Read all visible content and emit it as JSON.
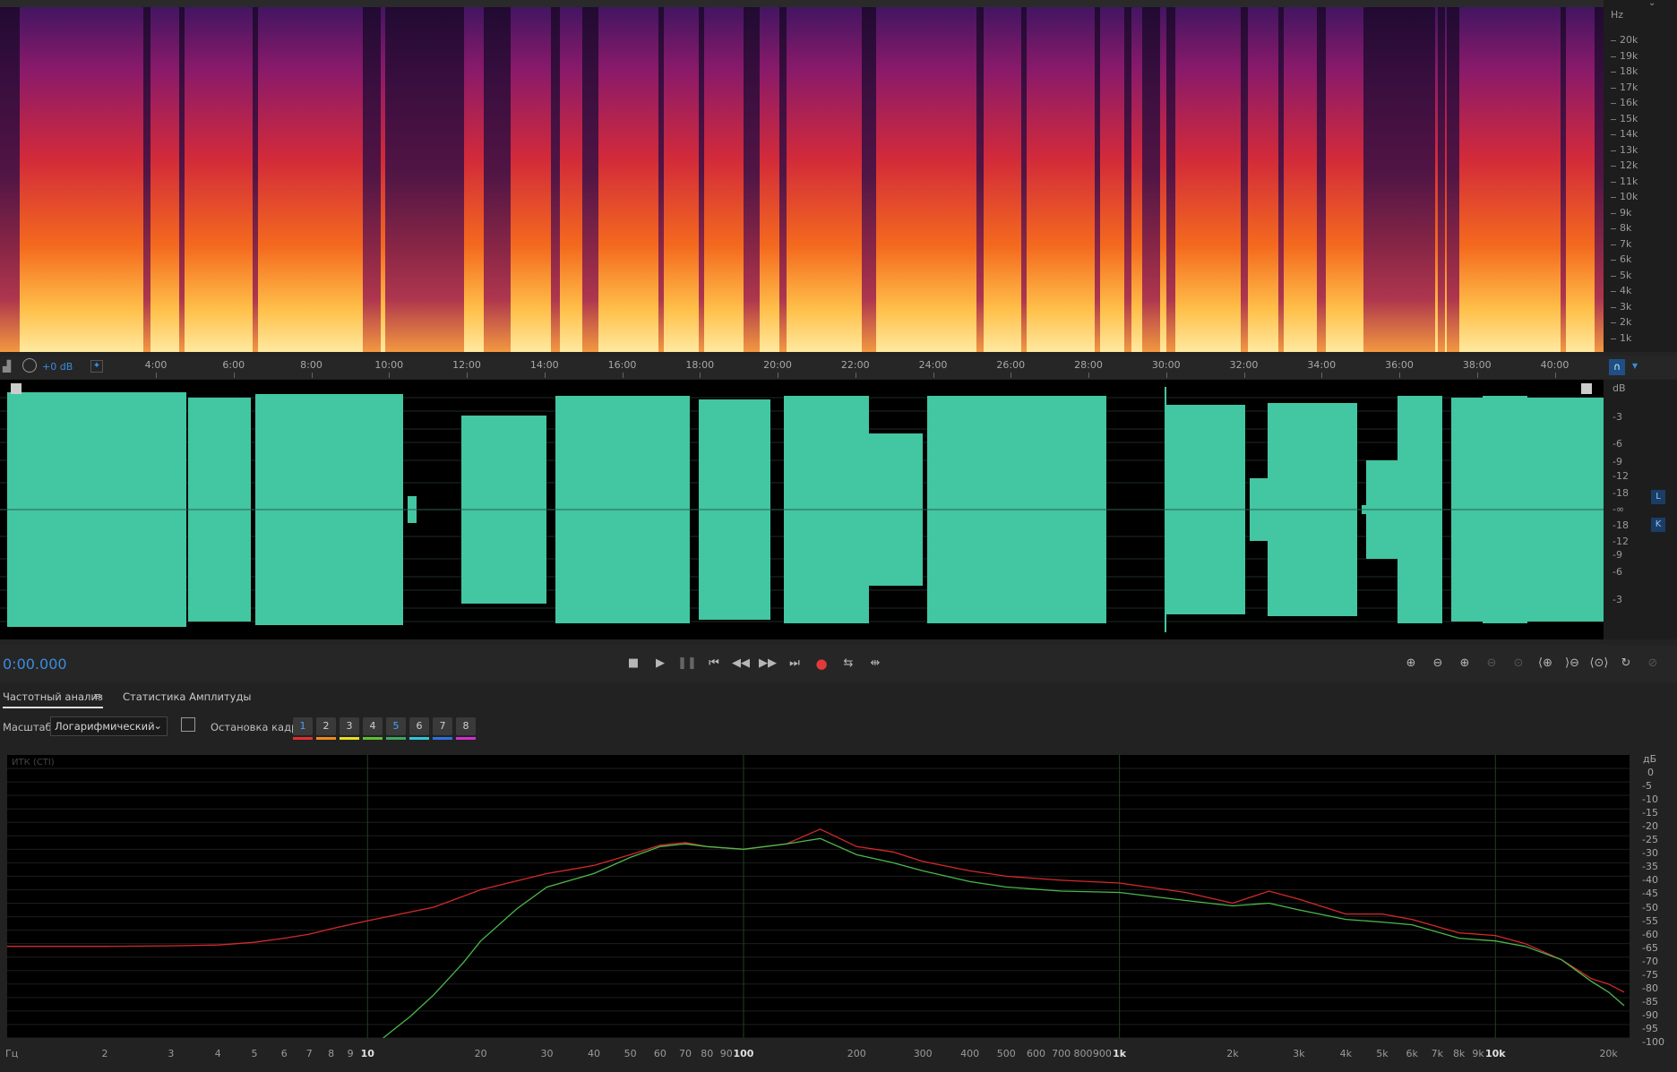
{
  "spectrogram": {
    "unit_label": "Hz",
    "ticks": [
      "20k",
      "19k",
      "18k",
      "17k",
      "16k",
      "15k",
      "14k",
      "13k",
      "12k",
      "11k",
      "10k",
      "9k",
      "8k",
      "7k",
      "6k",
      "5k",
      "4k",
      "3k",
      "2k",
      "1k"
    ]
  },
  "timeline": {
    "gain_label": "+0 dB",
    "ticks": [
      "4:00",
      "6:00",
      "8:00",
      "10:00",
      "12:00",
      "14:00",
      "16:00",
      "18:00",
      "20:00",
      "22:00",
      "24:00",
      "26:00",
      "28:00",
      "30:00",
      "32:00",
      "34:00",
      "36:00",
      "38:00",
      "40:00"
    ]
  },
  "waveform": {
    "unit_label": "dB",
    "ticks_top": [
      "-3",
      "-6",
      "-9",
      "-12",
      "-18",
      "-∞"
    ],
    "ticks_bottom": [
      "-18",
      "-12",
      "-9",
      "-6",
      "-3"
    ],
    "channel_left": "L",
    "channel_right": "K"
  },
  "transport": {
    "timecode": "0:00.000"
  },
  "panel": {
    "tabs": [
      "Частотный анализ",
      "Статистика Амплитуды"
    ],
    "scale_label": "Масштаб:",
    "scale_value": "Логарифмический",
    "freeze_label": "Остановка кадра:",
    "frame_buttons": [
      "1",
      "2",
      "3",
      "4",
      "5",
      "6",
      "7",
      "8"
    ],
    "frame_colors": [
      "#e03030",
      "#f08a20",
      "#e8e020",
      "#60c030",
      "#40a860",
      "#30c8d8",
      "#3070e0",
      "#d030d0"
    ],
    "graph_watermark": "ИТК (CTI)"
  },
  "chart_data": {
    "type": "line",
    "xlabel": "Гц",
    "ylabel": "дБ",
    "x_scale": "log",
    "ylim": [
      -100,
      5
    ],
    "y_ticks": [
      "0",
      "-5",
      "-10",
      "-15",
      "-20",
      "-25",
      "-30",
      "-35",
      "-40",
      "-45",
      "-50",
      "-55",
      "-60",
      "-65",
      "-70",
      "-75",
      "-80",
      "-85",
      "-90",
      "-95",
      "-100"
    ],
    "x_ticks": [
      "2",
      "3",
      "4",
      "5",
      "6",
      "7",
      "8",
      "9",
      "10",
      "20",
      "30",
      "40",
      "50",
      "60",
      "70",
      "80",
      "90",
      "100",
      "200",
      "300",
      "400",
      "500",
      "600",
      "700",
      "800",
      "900",
      "1k",
      "2k",
      "3k",
      "4k",
      "5k",
      "6k",
      "7k",
      "8k",
      "9k",
      "10k",
      "20k"
    ],
    "series": [
      {
        "color": "#d42a2a",
        "x": [
          1,
          2,
          3,
          4,
          5,
          6,
          7,
          8,
          10,
          15,
          20,
          30,
          40,
          50,
          60,
          70,
          80,
          100,
          130,
          160,
          200,
          250,
          300,
          400,
          500,
          700,
          1000,
          1500,
          2000,
          2500,
          3000,
          4000,
          5000,
          6000,
          8000,
          10000,
          12000,
          15000,
          18000,
          20000,
          22000
        ],
        "y": [
          -66,
          -66,
          -65.8,
          -65.5,
          -64.5,
          -63,
          -61.5,
          -59.5,
          -56.5,
          -51.5,
          -45,
          -39,
          -36,
          -32,
          -28.5,
          -27.5,
          -29,
          -30,
          -28,
          -22.5,
          -29,
          -31,
          -34.5,
          -38,
          -40,
          -41.5,
          -42.5,
          -46,
          -50,
          -45.5,
          -48.5,
          -54,
          -54,
          -56,
          -61,
          -62,
          -65,
          -71,
          -78,
          -80,
          -83
        ]
      },
      {
        "color": "#4bb84b",
        "x": [
          11,
          13,
          15,
          18,
          20,
          25,
          30,
          40,
          50,
          60,
          70,
          80,
          100,
          130,
          160,
          200,
          250,
          300,
          400,
          500,
          700,
          1000,
          1500,
          2000,
          2500,
          3000,
          4000,
          5000,
          6000,
          8000,
          10000,
          12000,
          15000,
          18000,
          20000,
          22000
        ],
        "y": [
          -100,
          -92,
          -84,
          -72,
          -64,
          -52,
          -44,
          -39,
          -33,
          -29,
          -28,
          -29,
          -30,
          -28,
          -26,
          -32,
          -35,
          -38,
          -42,
          -44,
          -45.5,
          -46,
          -49,
          -51,
          -50,
          -52.5,
          -56,
          -57,
          -58,
          -63,
          -64,
          -66,
          -71,
          -79,
          -83,
          -88
        ]
      }
    ]
  }
}
